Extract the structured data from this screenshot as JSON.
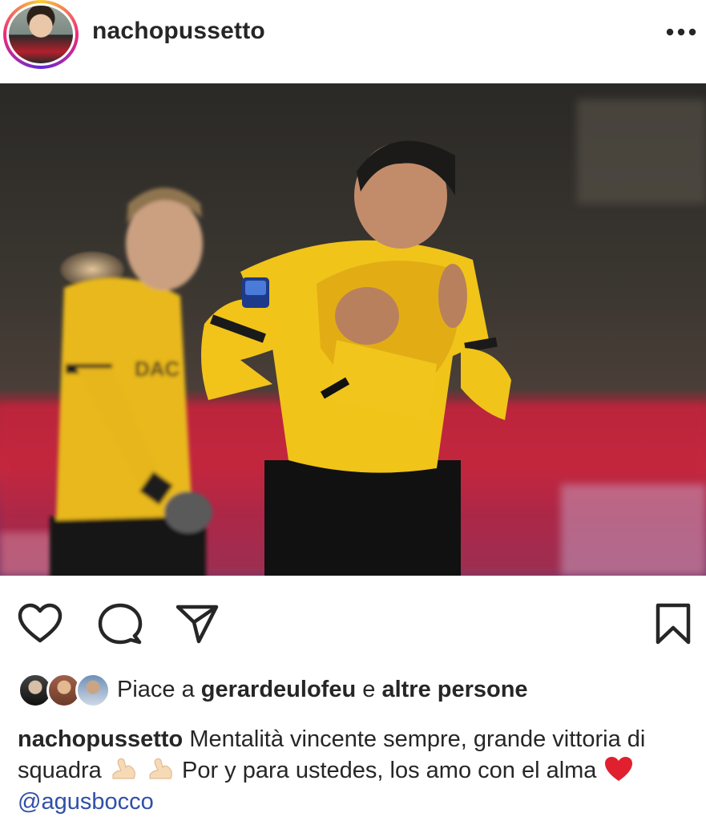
{
  "post": {
    "username": "nachopussetto",
    "photo_alt": "",
    "likes": {
      "prefix": "Piace a",
      "liker": "gerardeulofeu",
      "connector": "e",
      "others": "altre persone"
    },
    "caption": {
      "author": "nachopussetto",
      "text_part1": "Mentalità vincente sempre, grande vittoria di squadra",
      "text_part2": "Por y para ustedes, los amo con el alma",
      "mention": "@agusbocco"
    }
  },
  "icons": {
    "more": "more-options-icon",
    "like": "heart-icon",
    "comment": "comment-bubble-icon",
    "share": "paper-plane-icon",
    "save": "bookmark-icon",
    "emoji_arm": "flexed-biceps-icon",
    "emoji_heart": "red-heart-icon"
  },
  "colors": {
    "mention": "#2f4fa8",
    "heart_emoji": "#e0202e",
    "kit_yellow": "#f0c419"
  }
}
